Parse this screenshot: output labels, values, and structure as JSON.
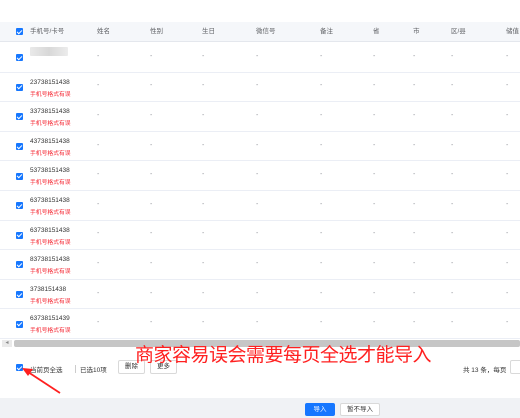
{
  "table": {
    "columns": [
      "手机号/卡号",
      "姓名",
      "性别",
      "生日",
      "微信号",
      "备注",
      "省",
      "市",
      "区/县",
      "储值"
    ],
    "rows": [
      {
        "phone": "",
        "error": ""
      },
      {
        "phone": "23738151438",
        "error": "手机号格式有误"
      },
      {
        "phone": "33738151438",
        "error": "手机号格式有误"
      },
      {
        "phone": "43738151438",
        "error": "手机号格式有误"
      },
      {
        "phone": "53738151438",
        "error": "手机号格式有误"
      },
      {
        "phone": "63738151438",
        "error": "手机号格式有误"
      },
      {
        "phone": "63738151438",
        "error": "手机号格式有误"
      },
      {
        "phone": "83738151438",
        "error": "手机号格式有误"
      },
      {
        "phone": "3738151438",
        "error": "手机号格式有误"
      },
      {
        "phone": "63738151439",
        "error": "手机号格式有误"
      }
    ],
    "empty_cell": "-"
  },
  "footer": {
    "select_page_label": "当前页全选",
    "selected_count": "已选10项",
    "delete_label": "删除",
    "more_label": "更多",
    "pagination_total": "共 13 条，每页"
  },
  "annotation": {
    "text": "商家容易误会需要每页全选才能导入",
    "color": "#ff2020"
  },
  "actions": {
    "import_label": "导入",
    "no_import_label": "暂不导入"
  },
  "colors": {
    "primary": "#1677ff",
    "error": "#f5222d"
  }
}
